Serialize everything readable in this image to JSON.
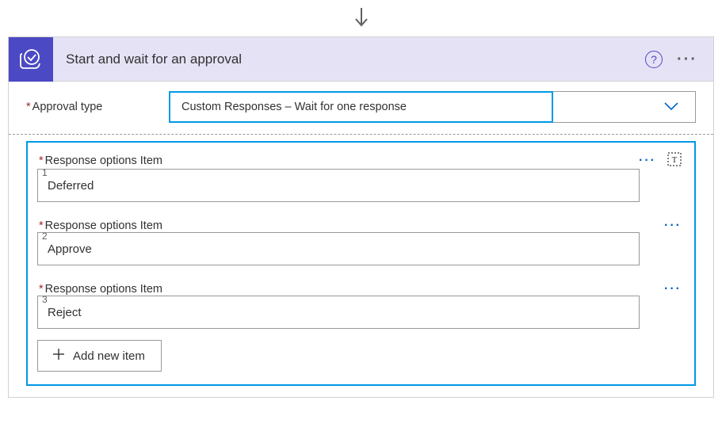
{
  "connector": {
    "direction": "down"
  },
  "card": {
    "title": "Start and wait for an approval",
    "help_tooltip": "?",
    "type_row": {
      "label": "Approval type",
      "value": "Custom Responses – Wait for one response"
    },
    "options": {
      "label_prefix": "Response options Item",
      "items": [
        {
          "index": "1",
          "value": "Deferred",
          "show_toggle": true
        },
        {
          "index": "2",
          "value": "Approve",
          "show_toggle": false
        },
        {
          "index": "3",
          "value": "Reject",
          "show_toggle": false
        }
      ],
      "add_label": "Add new item"
    }
  }
}
